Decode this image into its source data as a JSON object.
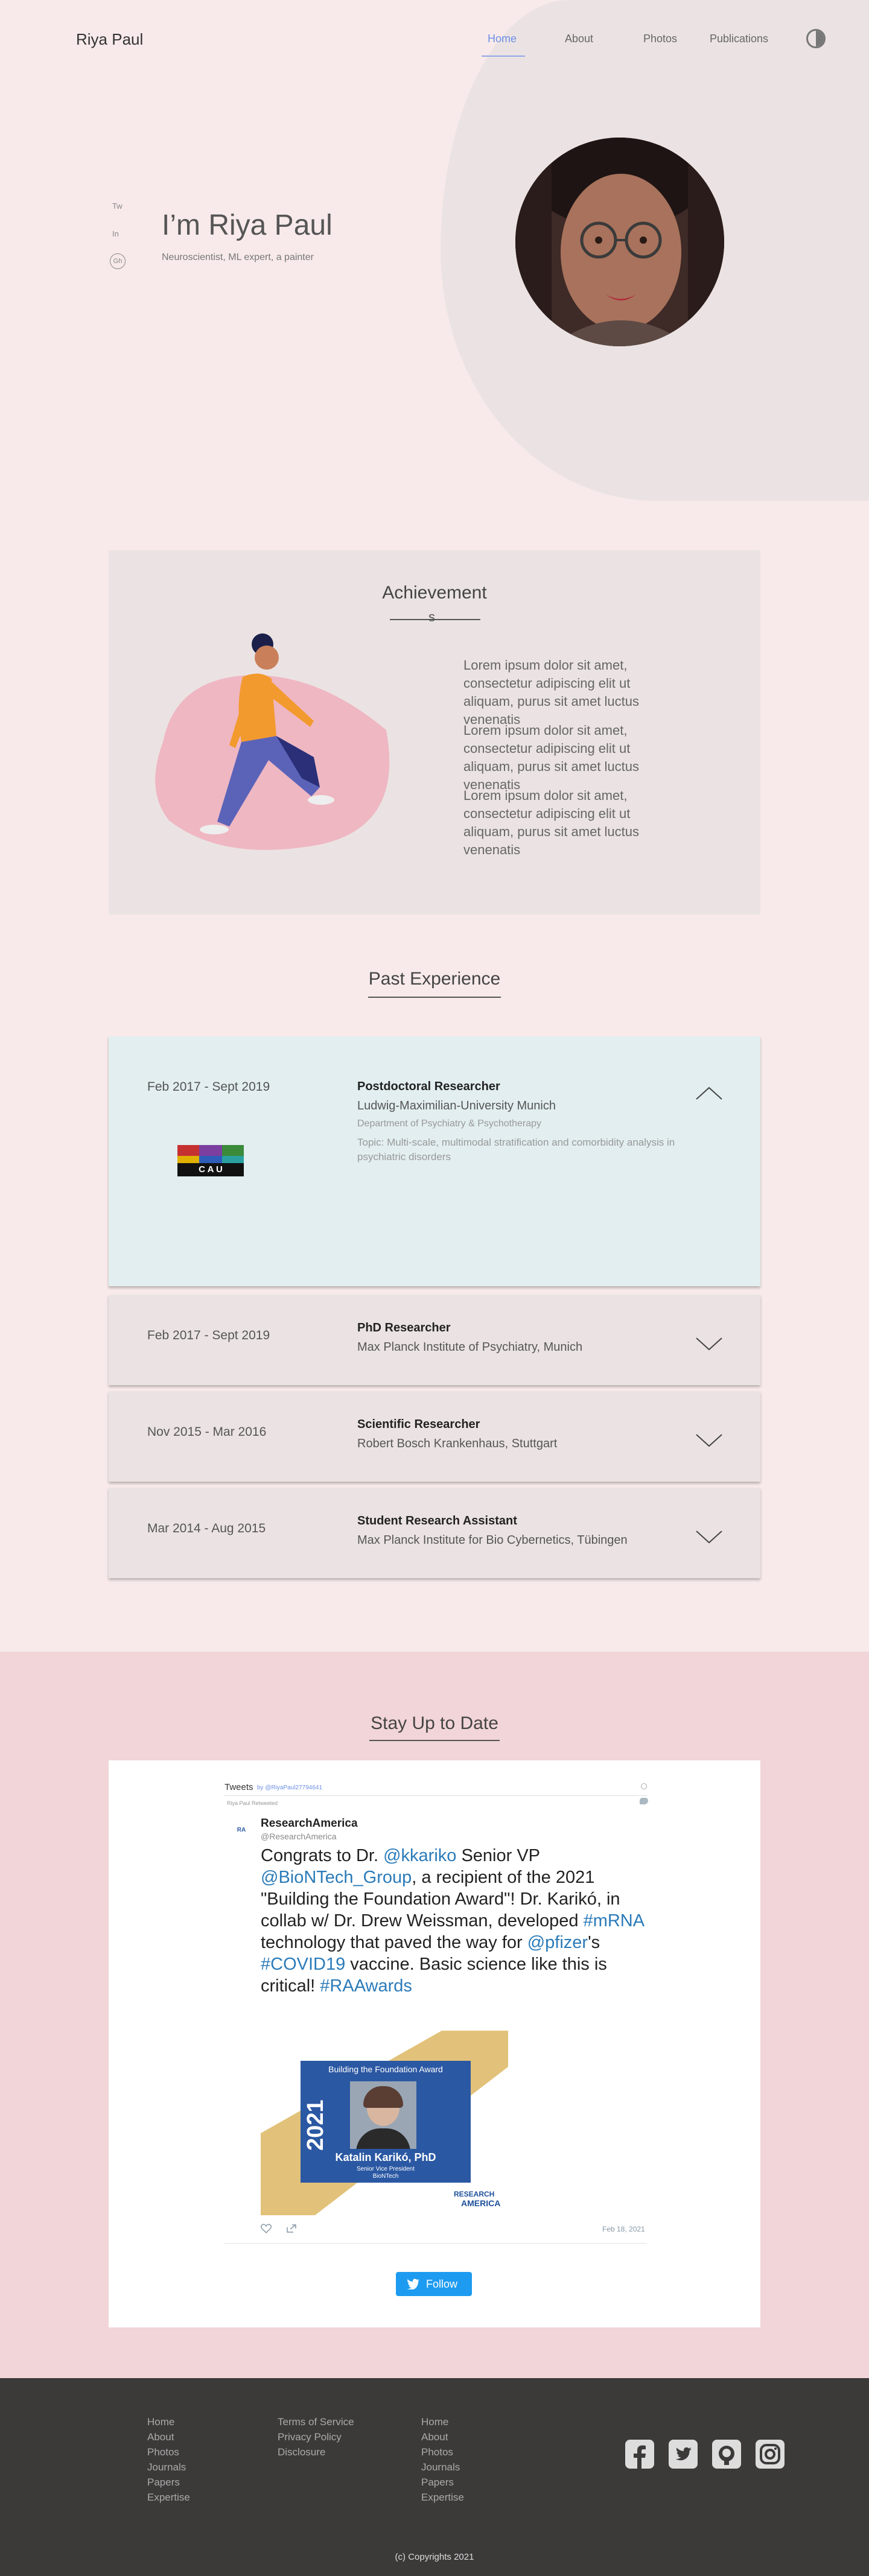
{
  "header": {
    "logo": "Riya Paul",
    "nav": [
      "Home",
      "About",
      "Photos",
      "Publications"
    ]
  },
  "hero": {
    "social": [
      "Tw",
      "In",
      "Gh"
    ],
    "title": "I’m Riya Paul",
    "subtitle": "Neuroscientist, ML expert, a painter"
  },
  "achievement": {
    "title": "Achievement",
    "marker": "s",
    "paragraphs": [
      "Lorem ipsum dolor sit amet, consectetur adipiscing elit ut aliquam, purus sit amet luctus venenatis",
      "Lorem ipsum dolor sit amet, consectetur adipiscing elit ut aliquam, purus sit amet luctus venenatis",
      "Lorem ipsum dolor sit amet, consectetur adipiscing elit ut aliquam, purus sit amet luctus venenatis"
    ]
  },
  "experience": {
    "title": "Past Experience",
    "items": [
      {
        "date": "Feb 2017 - Sept 2019",
        "role": "Postdoctoral Researcher",
        "institution": "Ludwig-Maximilian-University Munich",
        "department": "Department of Psychiatry & Psychotherapy",
        "topic": "Topic: Multi-scale, multimodal stratification and comorbidity analysis in psychiatric disorders",
        "logo_text": "C A U"
      },
      {
        "date": "Feb 2017 - Sept 2019",
        "role": "PhD Researcher",
        "institution": "Max Planck Institute of Psychiatry, Munich"
      },
      {
        "date": "Nov 2015 - Mar 2016",
        "role": "Scientific Researcher",
        "institution": "Robert Bosch Krankenhaus, Stuttgart"
      },
      {
        "date": "Mar 2014 - Aug 2015",
        "role": "Student Research Assistant",
        "institution": "Max Planck Institute for Bio Cybernetics, Tübingen"
      }
    ]
  },
  "updates": {
    "title": "Stay Up to Date",
    "feed_header": "Tweets",
    "feed_by": "by @RiyaPaul27794641",
    "pinned": "Riya Paul Retweeted",
    "account_name": "ResearchAmerica",
    "account_handle": "@ResearchAmerica",
    "tweet": {
      "p1": "Congrats to Dr. ",
      "l1": "@kkariko",
      "p2": " Senior VP ",
      "l2": "@BioNTech_Group",
      "p3": ", a recipient of the 2021 \"Building the Foundation Award\"! Dr. Karikó, in collab w/ Dr. Drew Weissman, developed ",
      "l3": "#mRNA",
      "p4": " technology that paved the way for ",
      "l4": "@pfizer",
      "p5": "'s ",
      "l5": "#COVID19",
      "p6": " vaccine. Basic science like this is critical! ",
      "l6": "#RAAwards"
    },
    "award": {
      "title": "Building the Foundation Award",
      "year": "2021",
      "name": "Katalin Karikó, PhD",
      "role": "Senior Vice President",
      "org": "BioNTech",
      "brand_top": "RESEARCH",
      "brand_bottom": "AMERICA"
    },
    "date": "Feb 18, 2021",
    "follow": "Follow"
  },
  "footer": {
    "col1": [
      "Home",
      "About",
      "Photos",
      "Journals",
      "Papers",
      "Expertise"
    ],
    "col2": [
      "Terms of Service",
      "Privacy Policy",
      "Disclosure"
    ],
    "col3": [
      "Home",
      "About",
      "Photos",
      "Journals",
      "Papers",
      "Expertise"
    ],
    "copyright": "(c) Copyrights 2021"
  },
  "colors": {
    "background": "#f8eaea",
    "accent": "#6d8fe6",
    "twitter": "#1d9bf0",
    "footer": "#3c3939"
  }
}
